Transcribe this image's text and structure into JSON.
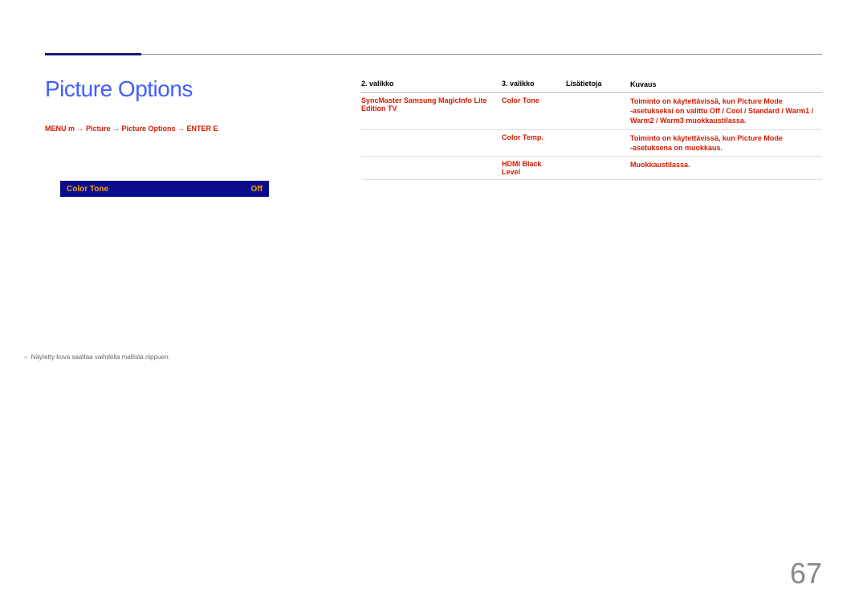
{
  "chapter_rule": true,
  "title_group": "Picture Options",
  "breadcrumb": "MENU m → Picture → Picture Options → ENTER E",
  "menu": {
    "label": "Color Tone",
    "value": "Off"
  },
  "footnote": "Näytetty kuva saattaa vaihdella mallista riippuen.",
  "page_number": "67",
  "table": {
    "headers": [
      "2. valikko",
      "3. valikko",
      "Lisätietoja",
      "Kuvaus"
    ],
    "rows": [
      {
        "c1": "SyncMaster Samsung MagicInfo Lite Edition TV",
        "c2": "Color Tone",
        "c3": "",
        "c4": "Toiminto on käytettävissä, kun Picture Mode ‑asetukseksi on valittu Off / Cool / Standard / Warm1 / Warm2 / Warm3 muokkaustilassa."
      },
      {
        "c1": "",
        "c2": "Color Temp.",
        "c3": "",
        "c4": "Toiminto on käytettävissä, kun Picture Mode ‑asetuksena on muokkaus."
      },
      {
        "c1": "",
        "c2": "HDMI Black Level",
        "c3": "",
        "c4": "Muokkaustilassa."
      }
    ]
  }
}
